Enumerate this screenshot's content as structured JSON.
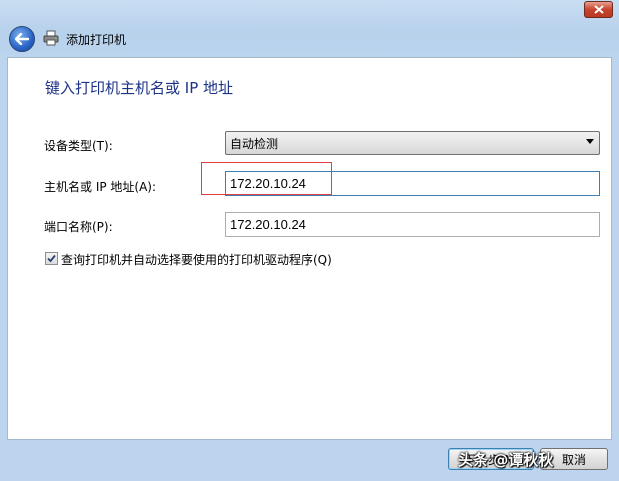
{
  "window": {
    "title": "添加打印机"
  },
  "page": {
    "heading": "键入打印机主机名或 IP 地址"
  },
  "form": {
    "device_type": {
      "label": "设备类型(T):",
      "value": "自动检测"
    },
    "hostname": {
      "label": "主机名或 IP 地址(A):",
      "value": "172.20.10.24"
    },
    "port_name": {
      "label": "端口名称(P):",
      "value": "172.20.10.24"
    },
    "query_driver": {
      "label": "查询打印机并自动选择要使用的打印机驱动程序(Q)",
      "checked": true
    }
  },
  "footer": {
    "next_label": "下一步(N)",
    "cancel_label": "取消"
  },
  "watermark": {
    "text": "头条 @谭秋秋"
  },
  "colors": {
    "heading": "#1e3287",
    "highlight_box": "#e04040",
    "focus_border": "#3c7fb1"
  }
}
